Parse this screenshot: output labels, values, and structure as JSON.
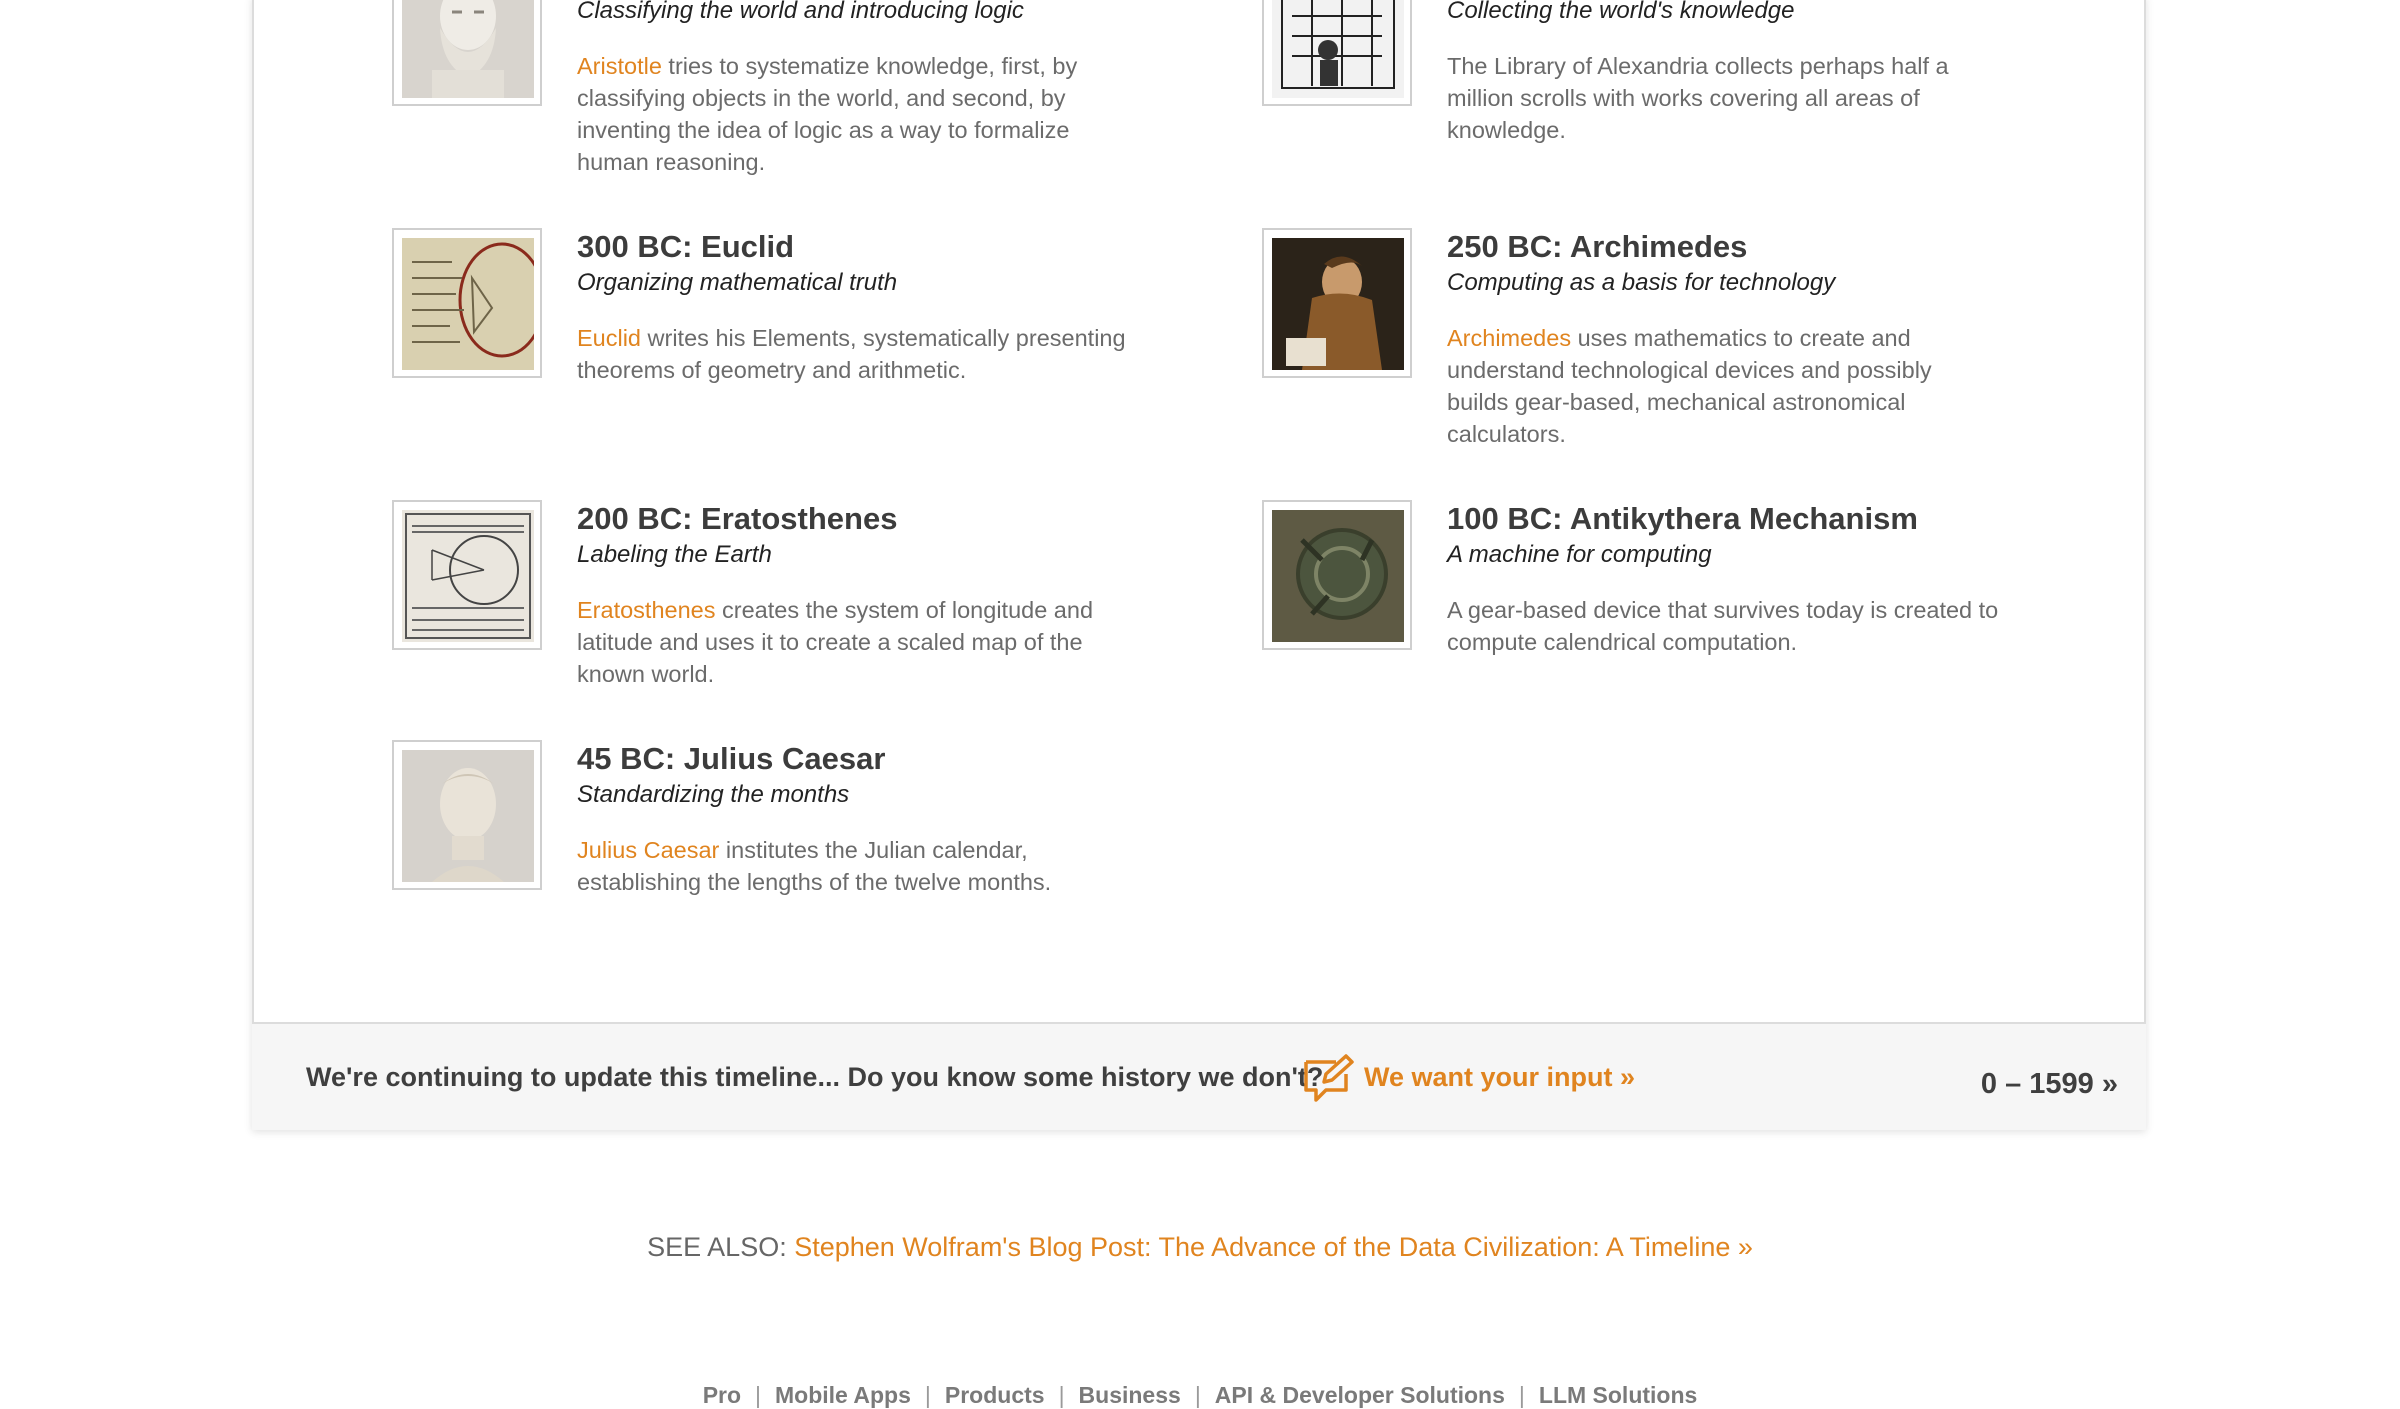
{
  "entries": [
    {
      "id": "aristotle",
      "title": "",
      "subtitle": "Classifying the world and introducing logic",
      "link": "Aristotle",
      "desc": " tries to systematize knowledge, first, by classifying objects in the world, and second, by inventing the idea of logic as a way to formalize human reasoning.",
      "image": "bust-of-aristotle"
    },
    {
      "id": "alexandria",
      "title": "",
      "subtitle": "Collecting the world's knowledge",
      "link": "",
      "desc": "The Library of Alexandria collects perhaps half a million scrolls with works covering all areas of knowledge.",
      "image": "library-engraving"
    },
    {
      "id": "euclid",
      "title": "300 BC: Euclid",
      "subtitle": "Organizing mathematical truth",
      "link": "Euclid",
      "desc": " writes his Elements, systematically presenting theorems of geometry and arithmetic.",
      "image": "elements-manuscript"
    },
    {
      "id": "archimedes",
      "title": "250 BC: Archimedes",
      "subtitle": "Computing as a basis for technology",
      "link": "Archimedes",
      "desc": " uses mathematics to create and understand technological devices and possibly builds gear-based, mechanical astronomical calculators.",
      "image": "archimedes-painting"
    },
    {
      "id": "eratosthenes",
      "title": "200 BC: Eratosthenes",
      "subtitle": "Labeling the Earth",
      "link": "Eratosthenes",
      "desc": " creates the system of longitude and latitude and uses it to create a scaled map of the known world.",
      "image": "earth-measurement-diagram"
    },
    {
      "id": "antikythera",
      "title": "100 BC: Antikythera Mechanism",
      "subtitle": "A machine for computing",
      "link": "",
      "desc": "A gear-based device that survives today is created to compute calendrical computation.",
      "image": "antikythera-fragment"
    },
    {
      "id": "caesar",
      "title": "45 BC: Julius Caesar",
      "subtitle": "Standardizing the months",
      "link": "Julius Caesar",
      "desc": " institutes the Julian calendar, establishing the lengths of the twelve months.",
      "image": "bust-of-caesar"
    }
  ],
  "footer": {
    "prompt": "We're continuing to update this timeline... Do you know some history we don't?",
    "input_link": "We want your input »",
    "next_range": "0 – 1599 »",
    "icon": "edit-comment-icon"
  },
  "see_also": {
    "label": "SEE ALSO: ",
    "link": "Stephen Wolfram's Blog Post: The Advance of the Data Civilization: A Timeline »"
  },
  "bottom_nav": [
    "Pro",
    "Mobile Apps",
    "Products",
    "Business",
    "API & Developer Solutions",
    "LLM Solutions"
  ],
  "colors": {
    "accent": "#e0841f",
    "title": "#3c3c3c",
    "body": "#6b6b6b",
    "bar": "#f6f6f6"
  }
}
